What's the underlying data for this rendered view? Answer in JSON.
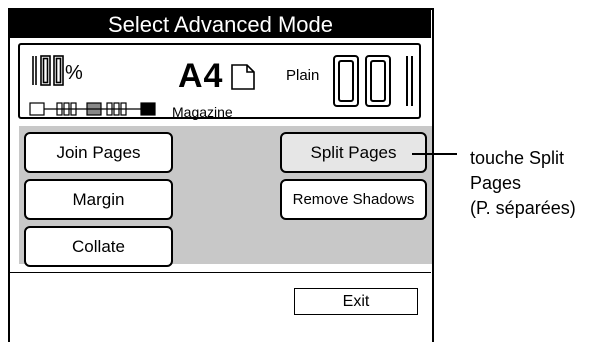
{
  "panel": {
    "title": "Select Advanced Mode",
    "status": {
      "zoom_value": "100",
      "zoom_unit": "%",
      "paper_size": "A4",
      "paper_icon": "portrait-page-icon",
      "paper_type": "Plain",
      "copy_count": "001",
      "document_type": "Magazine",
      "density_level": 3,
      "density_levels": 5
    },
    "buttons": {
      "join_pages": "Join Pages",
      "margin": "Margin",
      "collate": "Collate",
      "split_pages": "Split Pages",
      "remove_shadows": "Remove Shadows"
    },
    "exit": "Exit"
  },
  "callout": {
    "text_line1": "touche Split",
    "text_line2": "Pages",
    "text_line3": "(P. séparées)"
  },
  "colors": {
    "title_bar": "#000000",
    "work_area": "#c8c8c8",
    "active_button": "#e6e6e6"
  }
}
